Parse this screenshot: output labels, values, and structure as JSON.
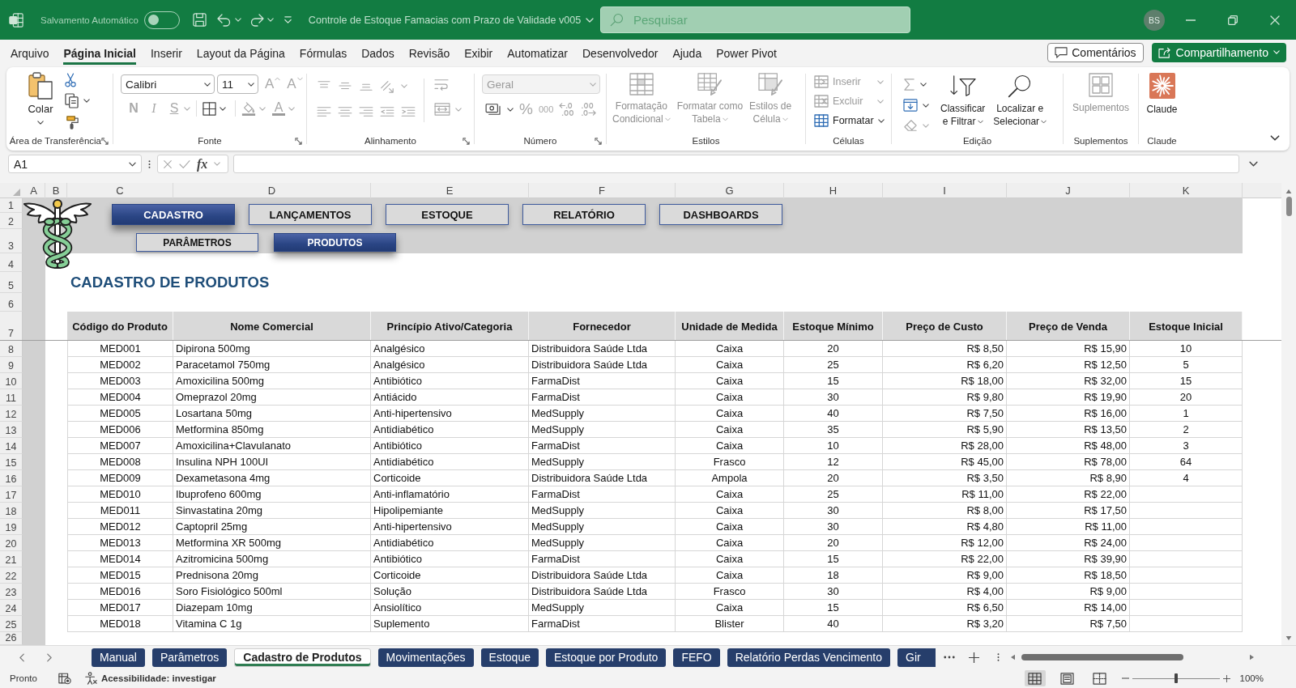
{
  "title_bar": {
    "autosave_label": "Salvamento Automático",
    "autosave_on": false,
    "document_title": "Controle de Estoque Famacias com Prazo de Validade v005",
    "search": {
      "placeholder": "Pesquisar"
    },
    "user_initials": "BS"
  },
  "menu": {
    "tabs": [
      {
        "label": "Arquivo",
        "selected": false
      },
      {
        "label": "Página Inicial",
        "selected": true
      },
      {
        "label": "Inserir",
        "selected": false
      },
      {
        "label": "Layout da Página",
        "selected": false
      },
      {
        "label": "Fórmulas",
        "selected": false
      },
      {
        "label": "Dados",
        "selected": false
      },
      {
        "label": "Revisão",
        "selected": false
      },
      {
        "label": "Exibir",
        "selected": false
      },
      {
        "label": "Automatizar",
        "selected": false
      },
      {
        "label": "Desenvolvedor",
        "selected": false
      },
      {
        "label": "Ajuda",
        "selected": false
      },
      {
        "label": "Power Pivot",
        "selected": false
      }
    ],
    "comments_button": "Comentários",
    "share_button": "Compartilhamento"
  },
  "ribbon": {
    "groups": [
      {
        "kind": "clipboard",
        "label": "Área de Transferência",
        "launcher": true,
        "paste_label": "Colar"
      },
      {
        "kind": "font",
        "label": "Fonte",
        "launcher": true,
        "font_name": "Calibri",
        "font_size": "11",
        "size_buttons": [
          {
            "label": "A",
            "disabled": true
          },
          {
            "label": "A",
            "disabled": true
          }
        ],
        "style_buttons": [
          {
            "label": "N",
            "disabled": true
          },
          {
            "label": "I",
            "disabled": true
          },
          {
            "label": "S",
            "disabled": true
          }
        ],
        "font_color_label": "A"
      },
      {
        "kind": "alignment",
        "label": "Alinhamento",
        "launcher": true
      },
      {
        "kind": "number",
        "label": "Número",
        "launcher": true,
        "format": {
          "value": "Geral",
          "disabled": true
        },
        "percent_label": "%",
        "thousands_label": "000"
      },
      {
        "kind": "styles",
        "label": "Estilos",
        "launcher": false,
        "buttons": [
          {
            "label": "Formatação\nCondicional",
            "disabled": true
          },
          {
            "label": "Formatar como\nTabela",
            "disabled": true
          },
          {
            "label": "Estilos de\nCélula",
            "disabled": true
          }
        ]
      },
      {
        "kind": "cells",
        "label": "Células",
        "launcher": false,
        "buttons": [
          {
            "label": "Inserir",
            "disabled": true
          },
          {
            "label": "Excluir",
            "disabled": true
          },
          {
            "label": "Formatar",
            "disabled": false
          }
        ]
      },
      {
        "kind": "editing",
        "label": "Edição",
        "launcher": false,
        "buttons": [
          {
            "label": "Classificar\ne Filtrar",
            "disabled": false
          },
          {
            "label": "Localizar e\nSelecionar",
            "disabled": false
          }
        ]
      },
      {
        "kind": "addins",
        "label": "Suplementos",
        "launcher": false,
        "buttons": [
          {
            "label": "Suplementos",
            "disabled": true
          }
        ]
      },
      {
        "kind": "claude",
        "label": "Claude",
        "launcher": false,
        "buttons": [
          {
            "label": "Claude",
            "disabled": false
          }
        ]
      }
    ]
  },
  "formula_bar": {
    "name_box": "A1",
    "fx_label": "fx"
  },
  "sheet": {
    "column_headers": [
      "A",
      "B",
      "C",
      "D",
      "E",
      "F",
      "G",
      "H",
      "I",
      "J",
      "K"
    ],
    "row_headers": [
      "1",
      "2",
      "3",
      "4",
      "5",
      "6",
      "7",
      "8",
      "9",
      "10",
      "11",
      "12",
      "13",
      "14",
      "15",
      "16",
      "17",
      "18",
      "19",
      "20",
      "21",
      "22",
      "23",
      "24",
      "25",
      "26"
    ],
    "nav": {
      "main": [
        {
          "label": "CADASTRO",
          "selected": true
        },
        {
          "label": "LANÇAMENTOS",
          "selected": false
        },
        {
          "label": "ESTOQUE",
          "selected": false
        },
        {
          "label": "RELATÓRIO",
          "selected": false
        },
        {
          "label": "DASHBOARDS",
          "selected": false
        }
      ],
      "sub": [
        {
          "label": "PARÂMETROS",
          "selected": false
        },
        {
          "label": "PRODUTOS",
          "selected": true
        }
      ]
    },
    "title": "CADASTRO DE PRODUTOS",
    "table": {
      "columns": [
        "Código do Produto",
        "Nome Comercial",
        "Princípio Ativo/Categoria",
        "Fornecedor",
        "Unidade de Medida",
        "Estoque Mínimo",
        "Preço de Custo",
        "Preço de Venda",
        "Estoque Inicial"
      ],
      "rows": [
        [
          "MED001",
          "Dipirona 500mg",
          "Analgésico",
          "Distribuidora Saúde Ltda",
          "Caixa",
          "20",
          "R$ 8,50",
          "R$ 15,90",
          "10"
        ],
        [
          "MED002",
          "Paracetamol 750mg",
          "Analgésico",
          "Distribuidora Saúde Ltda",
          "Caixa",
          "25",
          "R$ 6,20",
          "R$ 12,50",
          "5"
        ],
        [
          "MED003",
          "Amoxicilina 500mg",
          "Antibiótico",
          "FarmaDist",
          "Caixa",
          "15",
          "R$ 18,00",
          "R$ 32,00",
          "15"
        ],
        [
          "MED004",
          "Omeprazol 20mg",
          "Antiácido",
          "FarmaDist",
          "Caixa",
          "30",
          "R$ 9,80",
          "R$ 19,90",
          "20"
        ],
        [
          "MED005",
          "Losartana 50mg",
          "Anti-hipertensivo",
          "MedSupply",
          "Caixa",
          "40",
          "R$ 7,50",
          "R$ 16,00",
          "1"
        ],
        [
          "MED006",
          "Metformina 850mg",
          "Antidiabético",
          "MedSupply",
          "Caixa",
          "35",
          "R$ 5,90",
          "R$ 13,50",
          "2"
        ],
        [
          "MED007",
          "Amoxicilina+Clavulanato",
          "Antibiótico",
          "FarmaDist",
          "Caixa",
          "10",
          "R$ 28,00",
          "R$ 48,00",
          "3"
        ],
        [
          "MED008",
          "Insulina NPH 100UI",
          "Antidiabético",
          "MedSupply",
          "Frasco",
          "12",
          "R$ 45,00",
          "R$ 78,00",
          "64"
        ],
        [
          "MED009",
          "Dexametasona 4mg",
          "Corticoide",
          "Distribuidora Saúde Ltda",
          "Ampola",
          "20",
          "R$ 3,50",
          "R$ 8,90",
          "4"
        ],
        [
          "MED010",
          "Ibuprofeno 600mg",
          "Anti-inflamatório",
          "FarmaDist",
          "Caixa",
          "25",
          "R$ 11,00",
          "R$ 22,00"
        ],
        [
          "MED011",
          "Sinvastatina 20mg",
          "Hipolipemiante",
          "MedSupply",
          "Caixa",
          "30",
          "R$ 8,00",
          "R$ 17,50"
        ],
        [
          "MED012",
          "Captopril 25mg",
          "Anti-hipertensivo",
          "MedSupply",
          "Caixa",
          "30",
          "R$ 4,80",
          "R$ 11,00"
        ],
        [
          "MED013",
          "Metformina XR 500mg",
          "Antidiabético",
          "MedSupply",
          "Caixa",
          "20",
          "R$ 12,00",
          "R$ 24,00"
        ],
        [
          "MED014",
          "Azitromicina 500mg",
          "Antibiótico",
          "FarmaDist",
          "Caixa",
          "15",
          "R$ 22,00",
          "R$ 39,90"
        ],
        [
          "MED015",
          "Prednisona 20mg",
          "Corticoide",
          "Distribuidora Saúde Ltda",
          "Caixa",
          "18",
          "R$ 9,00",
          "R$ 18,50"
        ],
        [
          "MED016",
          "Soro Fisiológico 500ml",
          "Solução",
          "Distribuidora Saúde Ltda",
          "Frasco",
          "30",
          "R$ 4,00",
          "R$ 9,00"
        ],
        [
          "MED017",
          "Diazepam 10mg",
          "Ansiolítico",
          "MedSupply",
          "Caixa",
          "15",
          "R$ 6,50",
          "R$ 14,00"
        ],
        [
          "MED018",
          "Vitamina C 1g",
          "Suplemento",
          "FarmaDist",
          "Blister",
          "40",
          "R$ 3,20",
          "R$ 7,50"
        ]
      ]
    }
  },
  "sheet_tabs": {
    "tabs": [
      {
        "label": "Manual",
        "selected": false
      },
      {
        "label": "Parâmetros",
        "selected": false
      },
      {
        "label": "Cadastro de Produtos",
        "selected": true
      },
      {
        "label": "Movimentações",
        "selected": false
      },
      {
        "label": "Estoque",
        "selected": false
      },
      {
        "label": "Estoque por Produto",
        "selected": false
      },
      {
        "label": "FEFO",
        "selected": false
      },
      {
        "label": "Relatório Perdas Vencimento",
        "selected": false
      },
      {
        "label": "Gir",
        "selected": false
      }
    ]
  },
  "status_bar": {
    "ready": "Pronto",
    "accessibility": "Acessibilidade: investigar",
    "views": [
      {
        "kind": "normal",
        "selected": true
      },
      {
        "kind": "page_layout",
        "selected": false
      },
      {
        "kind": "page_break",
        "selected": false
      }
    ],
    "zoom": {
      "level": 0.5,
      "label": "100%"
    }
  }
}
